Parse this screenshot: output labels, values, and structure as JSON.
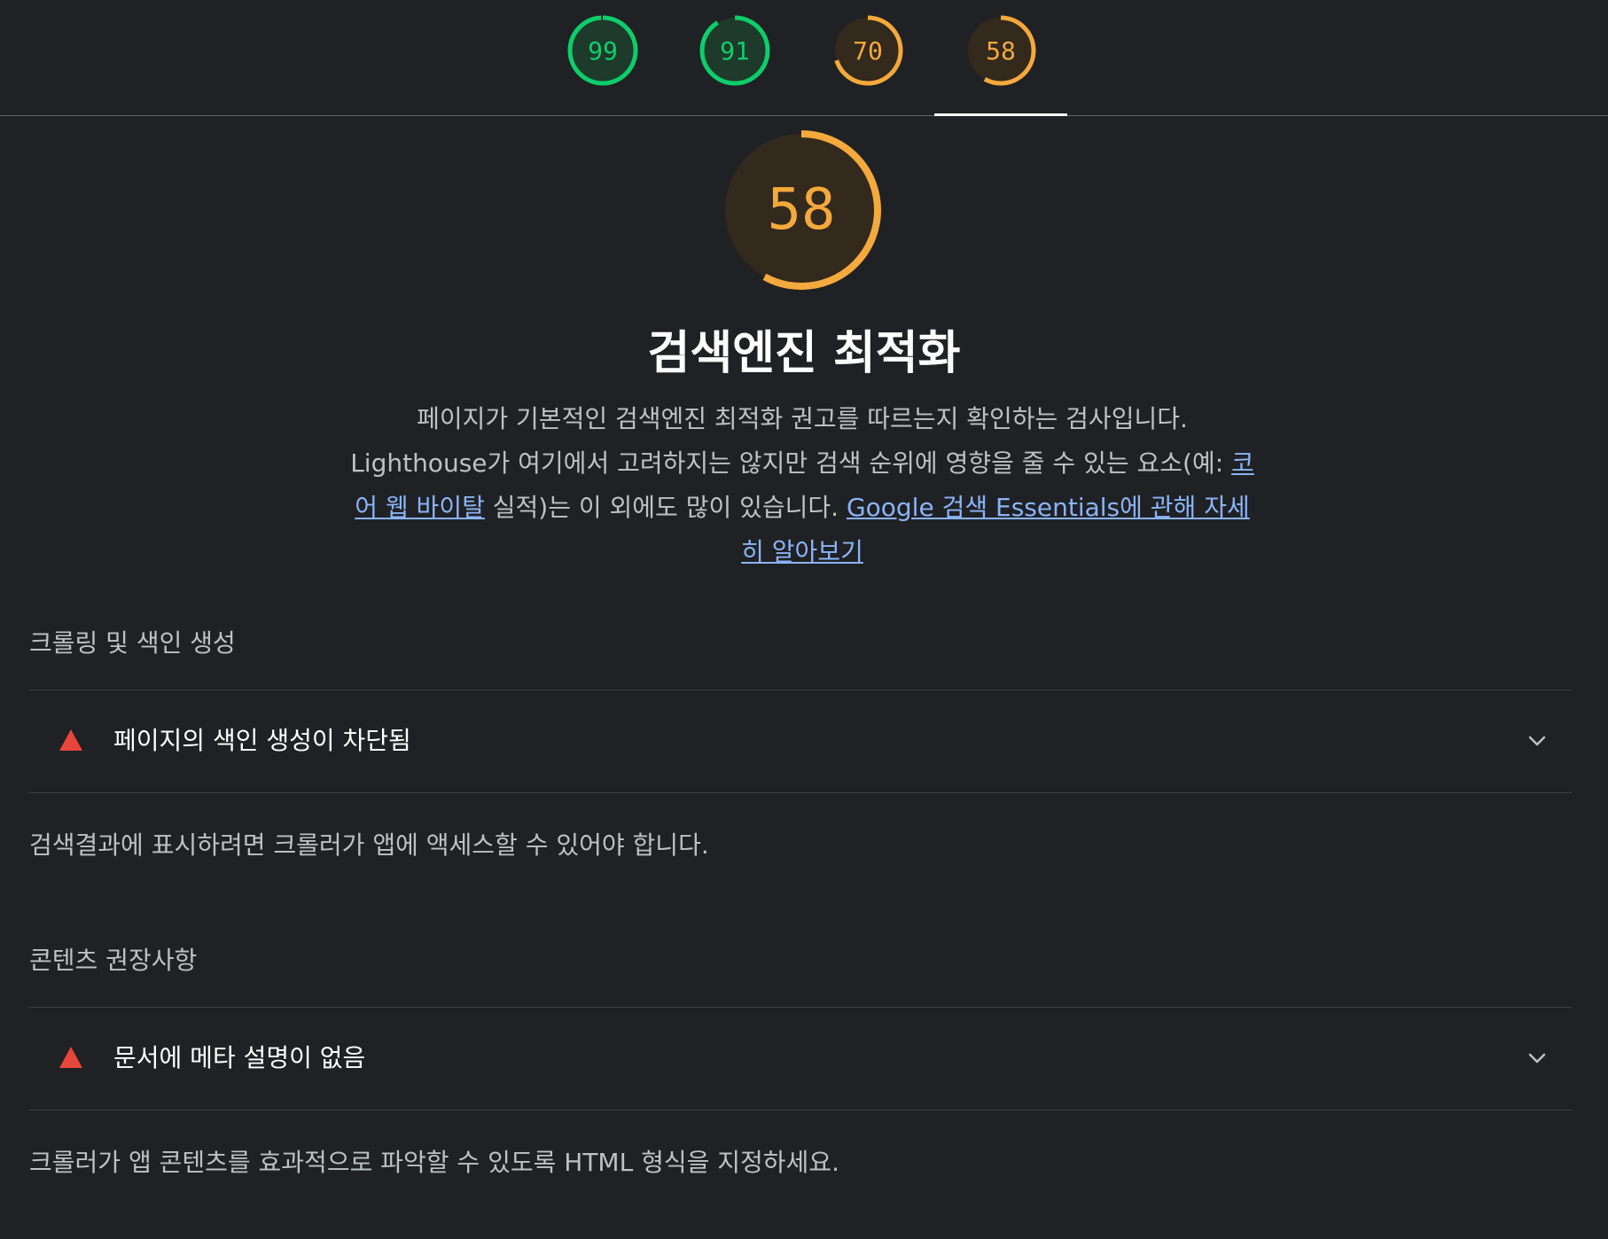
{
  "tabs": [
    {
      "score": "99",
      "label": "99",
      "color": "#0cce6b"
    },
    {
      "score": "91",
      "label": "91",
      "color": "#0cce6b"
    },
    {
      "score": "70",
      "label": "70",
      "color": "#f4a93c"
    },
    {
      "score": "58",
      "label": "58",
      "color": "#f4a93c",
      "selected": true
    }
  ],
  "category": {
    "score": "58",
    "score_fraction": 0.58,
    "title": "검색엔진 최적화",
    "desc_part1": "페이지가 기본적인 검색엔진 최적화 권고를 따르는지 확인하는 검사입니다. Lighthouse가 여기에서 고려하지는 않지만 검색 순위에 영향을 줄 수 있는 요소(예: ",
    "desc_link1": "코어 웹 바이탈",
    "desc_part2": " 실적)는 이 외에도 많이 있습니다. ",
    "desc_link2": "Google 검색 Essentials에 관해 자세히 알아보기"
  },
  "groups": [
    {
      "title": "크롤링 및 색인 생성",
      "audit_title": "페이지의 색인 생성이 차단됨",
      "description": "검색결과에 표시하려면 크롤러가 앱에 액세스할 수 있어야 합니다."
    },
    {
      "title": "콘텐츠 권장사항",
      "audit_title": "문서에 메타 설명이 없음",
      "description": "크롤러가 앱 콘텐츠를 효과적으로 파악할 수 있도록 HTML 형식을 지정하세요."
    }
  ],
  "icons": {
    "fail": "fail-triangle-icon",
    "expand": "chevron-down-icon"
  },
  "colors": {
    "pass": "#0cce6b",
    "average": "#f4a93c",
    "fail": "#e8453c",
    "link": "#8ab4f8",
    "background": "#202124"
  }
}
